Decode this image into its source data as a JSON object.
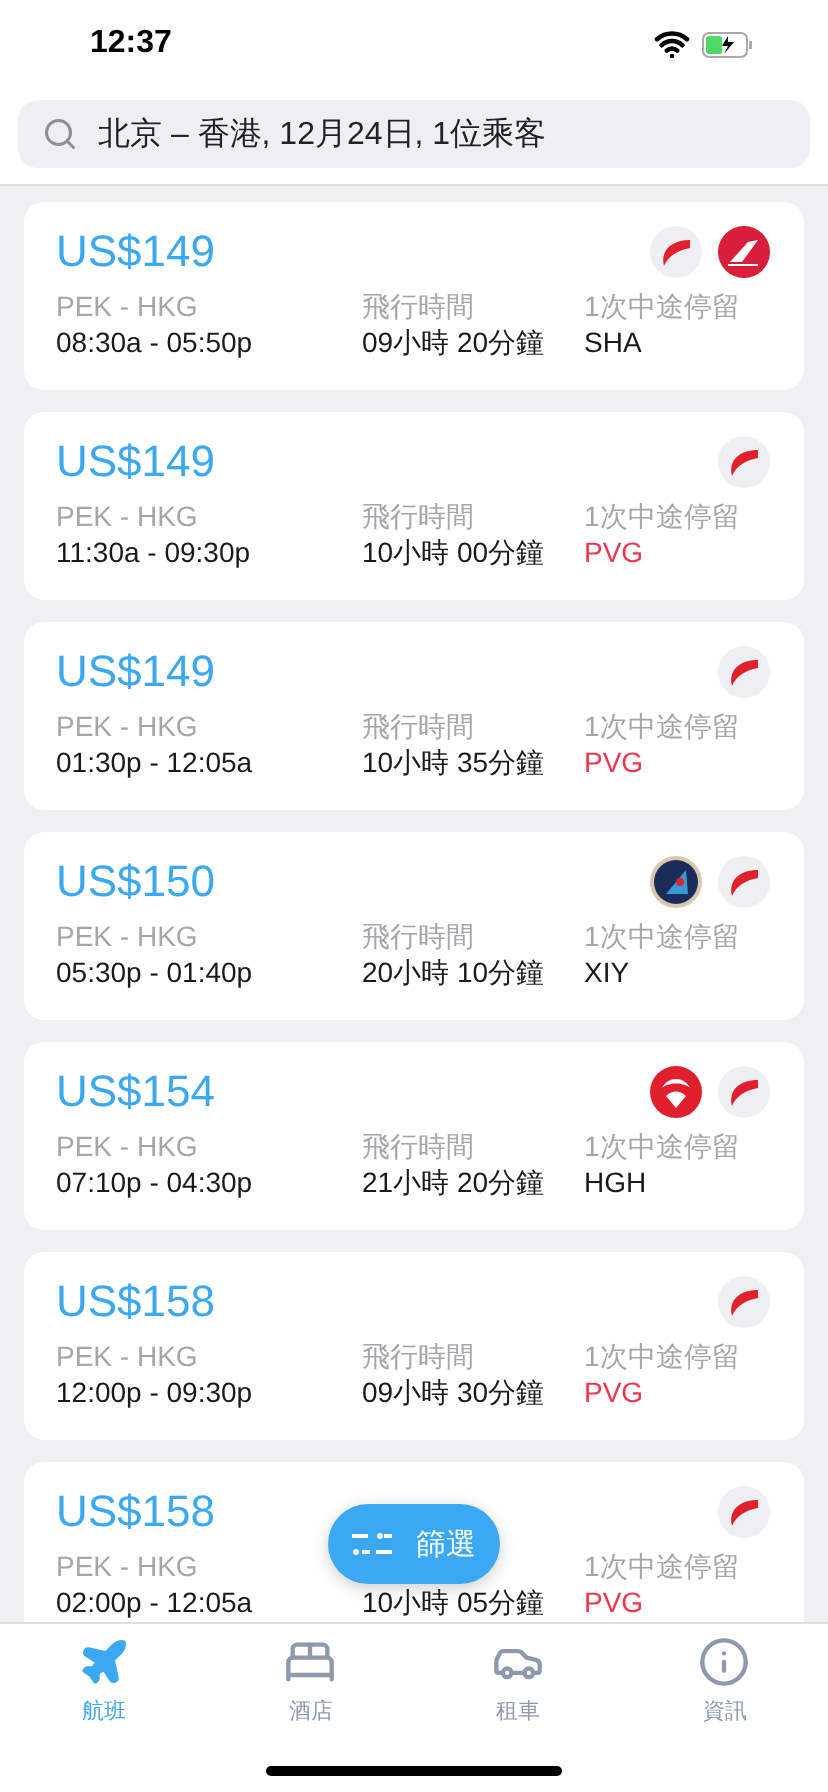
{
  "status_bar": {
    "time": "12:37"
  },
  "search": {
    "value": "北京 – 香港, 12月24日, 1位乘客"
  },
  "flights": [
    {
      "price": "US$149",
      "logos": [
        {
          "kind": "swoosh"
        },
        {
          "kind": "redtail"
        }
      ],
      "route": "PEK - HKG",
      "times": "08:30a - 05:50p",
      "duration_label": "飛行時間",
      "duration": "09小時 20分鐘",
      "stops_label": "1次中途停留",
      "stop": "SHA",
      "highlight": false
    },
    {
      "price": "US$149",
      "logos": [
        {
          "kind": "swoosh"
        }
      ],
      "route": "PEK - HKG",
      "times": "11:30a - 09:30p",
      "duration_label": "飛行時間",
      "duration": "10小時 00分鐘",
      "stops_label": "1次中途停留",
      "stop": "PVG",
      "highlight": true
    },
    {
      "price": "US$149",
      "logos": [
        {
          "kind": "swoosh"
        }
      ],
      "route": "PEK - HKG",
      "times": "01:30p - 12:05a",
      "duration_label": "飛行時間",
      "duration": "10小時 35分鐘",
      "stops_label": "1次中途停留",
      "stop": "PVG",
      "highlight": true
    },
    {
      "price": "US$150",
      "logos": [
        {
          "kind": "bluetail"
        },
        {
          "kind": "swoosh"
        }
      ],
      "route": "PEK - HKG",
      "times": "05:30p - 01:40p",
      "duration_label": "飛行時間",
      "duration": "20小時 10分鐘",
      "stops_label": "1次中途停留",
      "stop": "XIY",
      "highlight": false
    },
    {
      "price": "US$154",
      "logos": [
        {
          "kind": "emblem"
        },
        {
          "kind": "swoosh"
        }
      ],
      "route": "PEK - HKG",
      "times": "07:10p - 04:30p",
      "duration_label": "飛行時間",
      "duration": "21小時 20分鐘",
      "stops_label": "1次中途停留",
      "stop": "HGH",
      "highlight": false
    },
    {
      "price": "US$158",
      "logos": [
        {
          "kind": "swoosh"
        }
      ],
      "route": "PEK - HKG",
      "times": "12:00p - 09:30p",
      "duration_label": "飛行時間",
      "duration": "09小時 30分鐘",
      "stops_label": "1次中途停留",
      "stop": "PVG",
      "highlight": true
    },
    {
      "price": "US$158",
      "logos": [
        {
          "kind": "swoosh"
        }
      ],
      "route": "PEK - HKG",
      "times": "02:00p - 12:05a",
      "duration": "10小時 05分鐘",
      "stops_label": "1次中途停留",
      "stop": "PVG",
      "highlight": true
    }
  ],
  "filter_button": {
    "label": "篩選"
  },
  "tabs": [
    {
      "label": "航班",
      "selected": true
    },
    {
      "label": "酒店",
      "selected": false
    },
    {
      "label": "租車",
      "selected": false
    },
    {
      "label": "資訊",
      "selected": false
    }
  ]
}
